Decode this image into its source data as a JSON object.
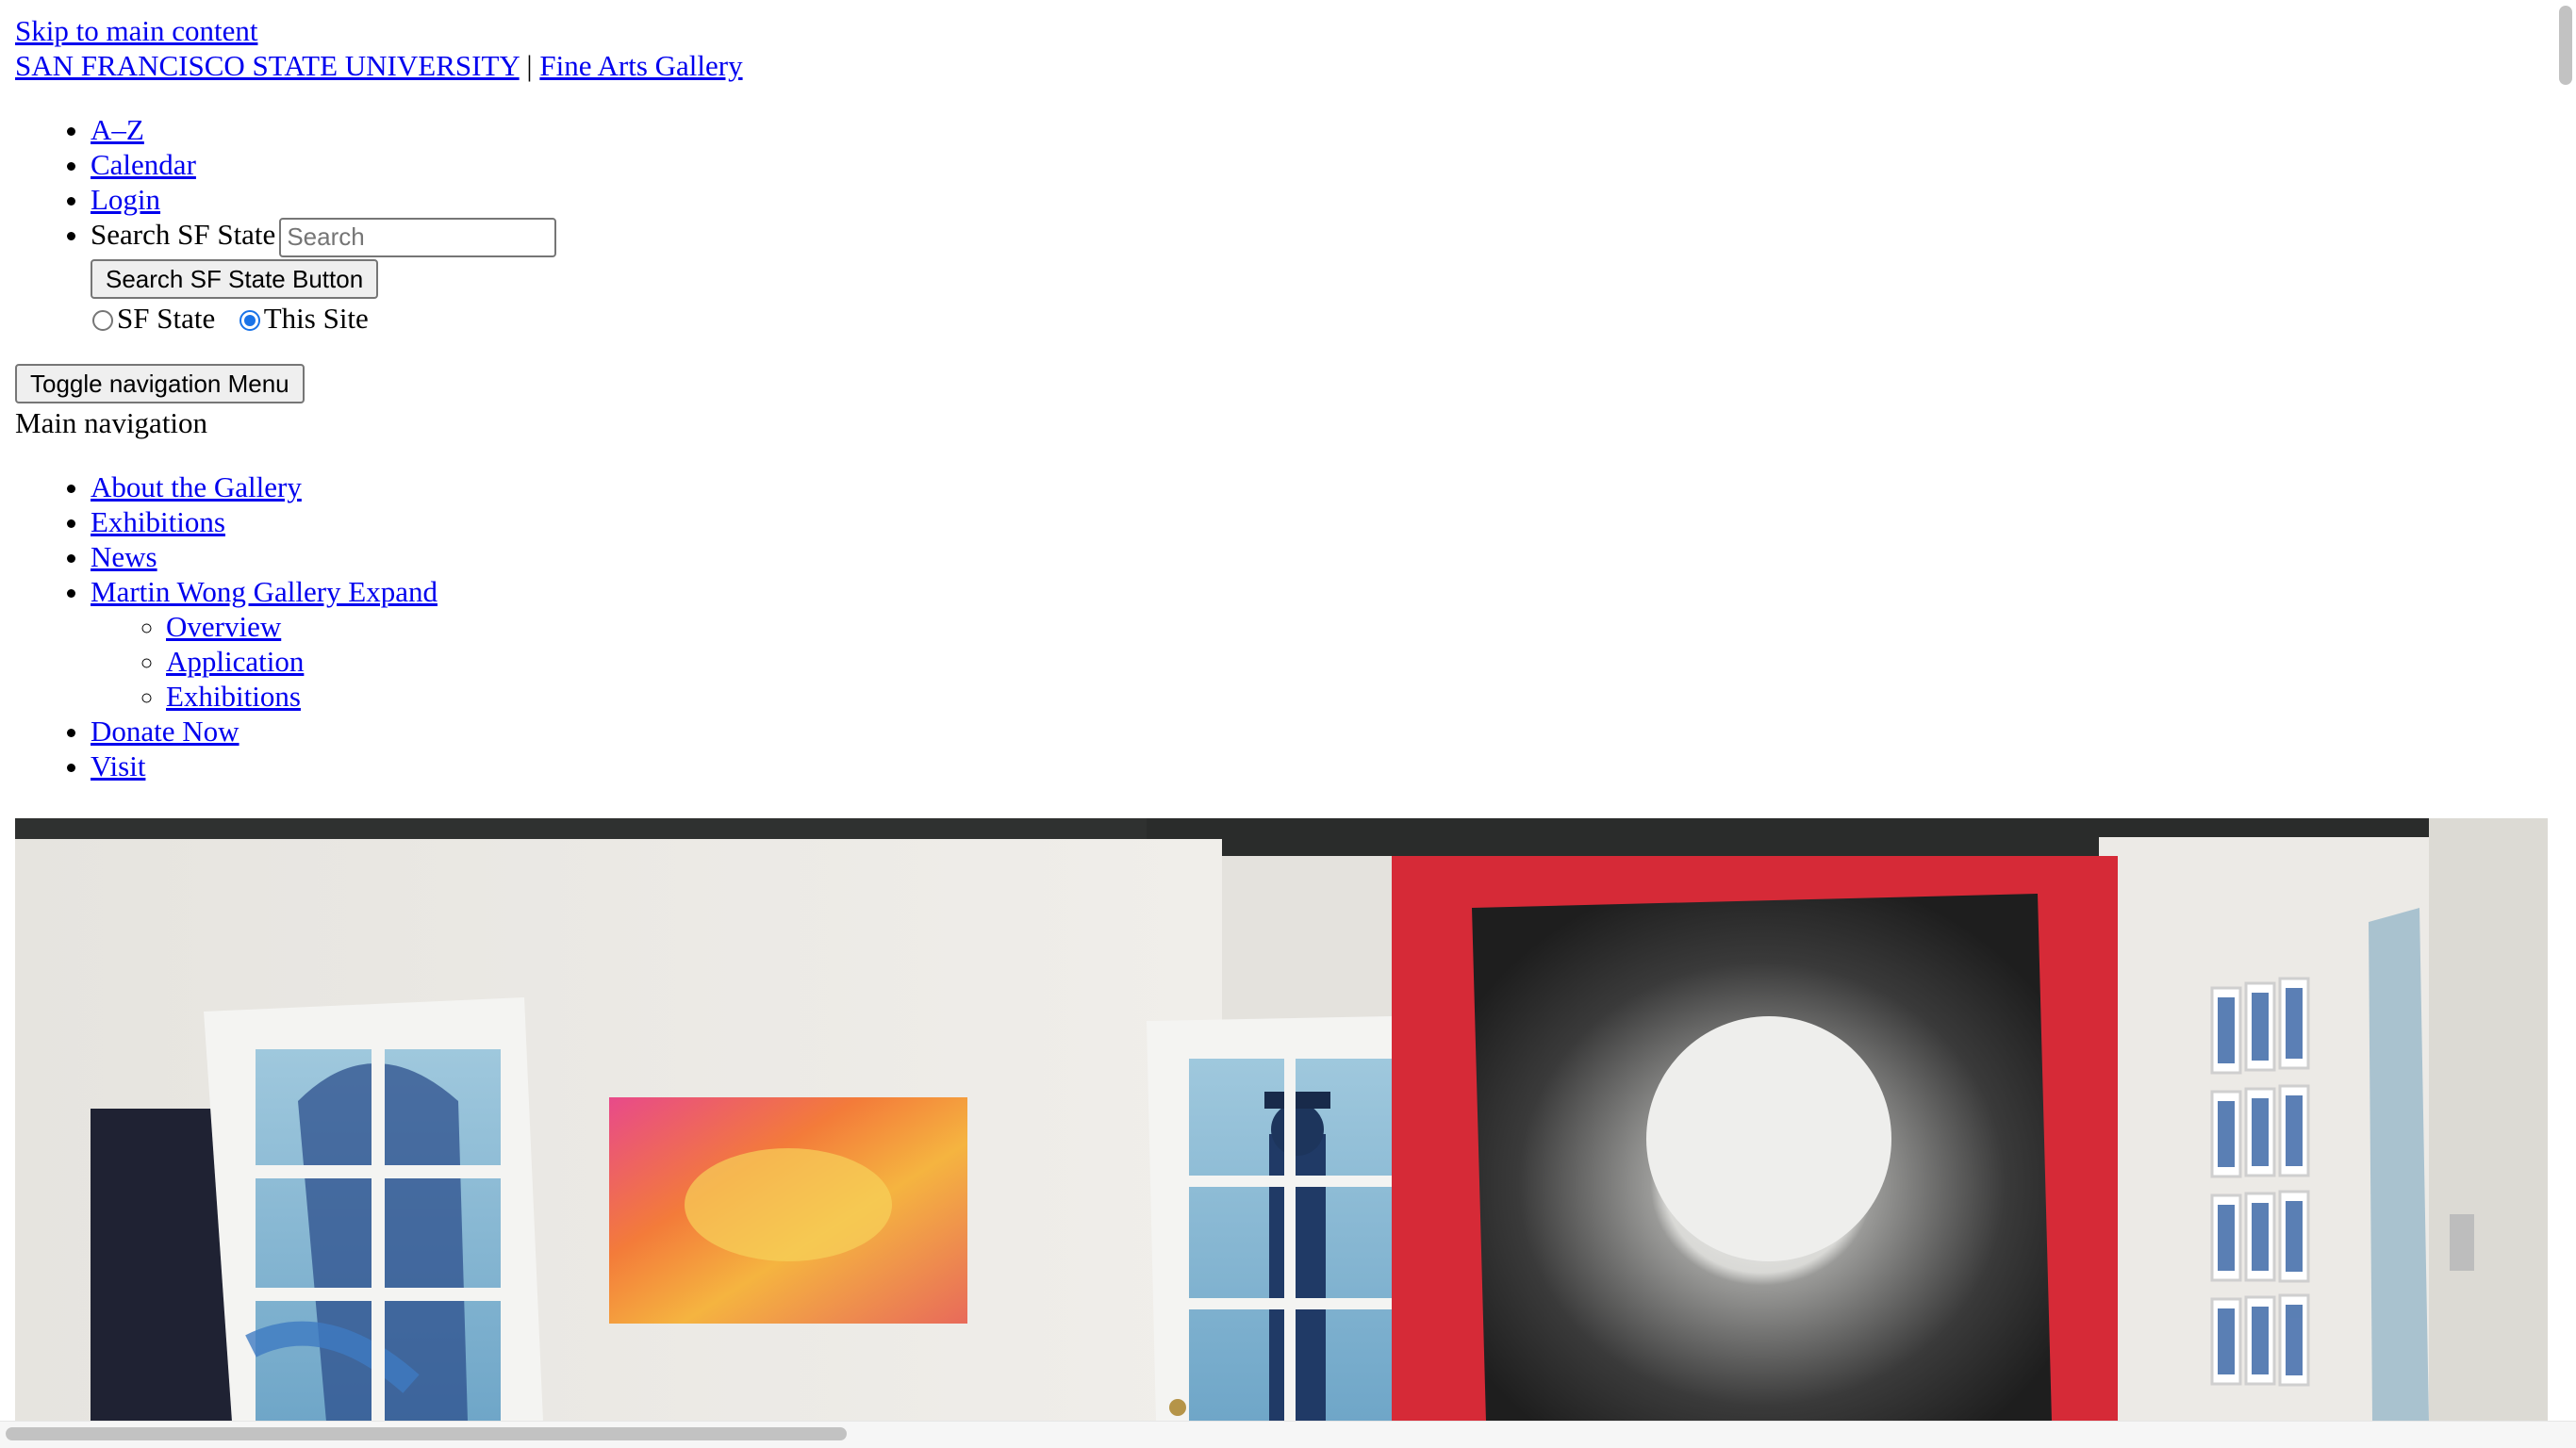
{
  "skip_link": "Skip to main content",
  "header": {
    "university": "SAN FRANCISCO STATE UNIVERSITY",
    "separator": "|",
    "site_name": "Fine Arts Gallery"
  },
  "utility_nav": {
    "items": [
      {
        "label": "A–Z"
      },
      {
        "label": "Calendar"
      },
      {
        "label": "Login"
      }
    ],
    "search": {
      "label": "Search SF State",
      "placeholder": "Search",
      "button": "Search SF State Button",
      "scope_options": [
        {
          "label": "SF State",
          "checked": false
        },
        {
          "label": "This Site",
          "checked": true
        }
      ]
    }
  },
  "toggle_button": "Toggle navigation Menu",
  "main_nav": {
    "label": "Main navigation",
    "items": [
      {
        "label": "About the Gallery"
      },
      {
        "label": "Exhibitions"
      },
      {
        "label": "News"
      },
      {
        "label": "Martin Wong Gallery Expand"
      },
      {
        "label": "Donate Now"
      },
      {
        "label": "Visit"
      }
    ],
    "submenu": [
      {
        "label": "Overview"
      },
      {
        "label": "Application"
      },
      {
        "label": "Exhibitions"
      }
    ]
  },
  "hero_image": {
    "alt": "gallery installation view"
  },
  "colors": {
    "link": "#0000ee",
    "radio_accent": "#1a73e8",
    "red_panel": "#d62a37"
  }
}
